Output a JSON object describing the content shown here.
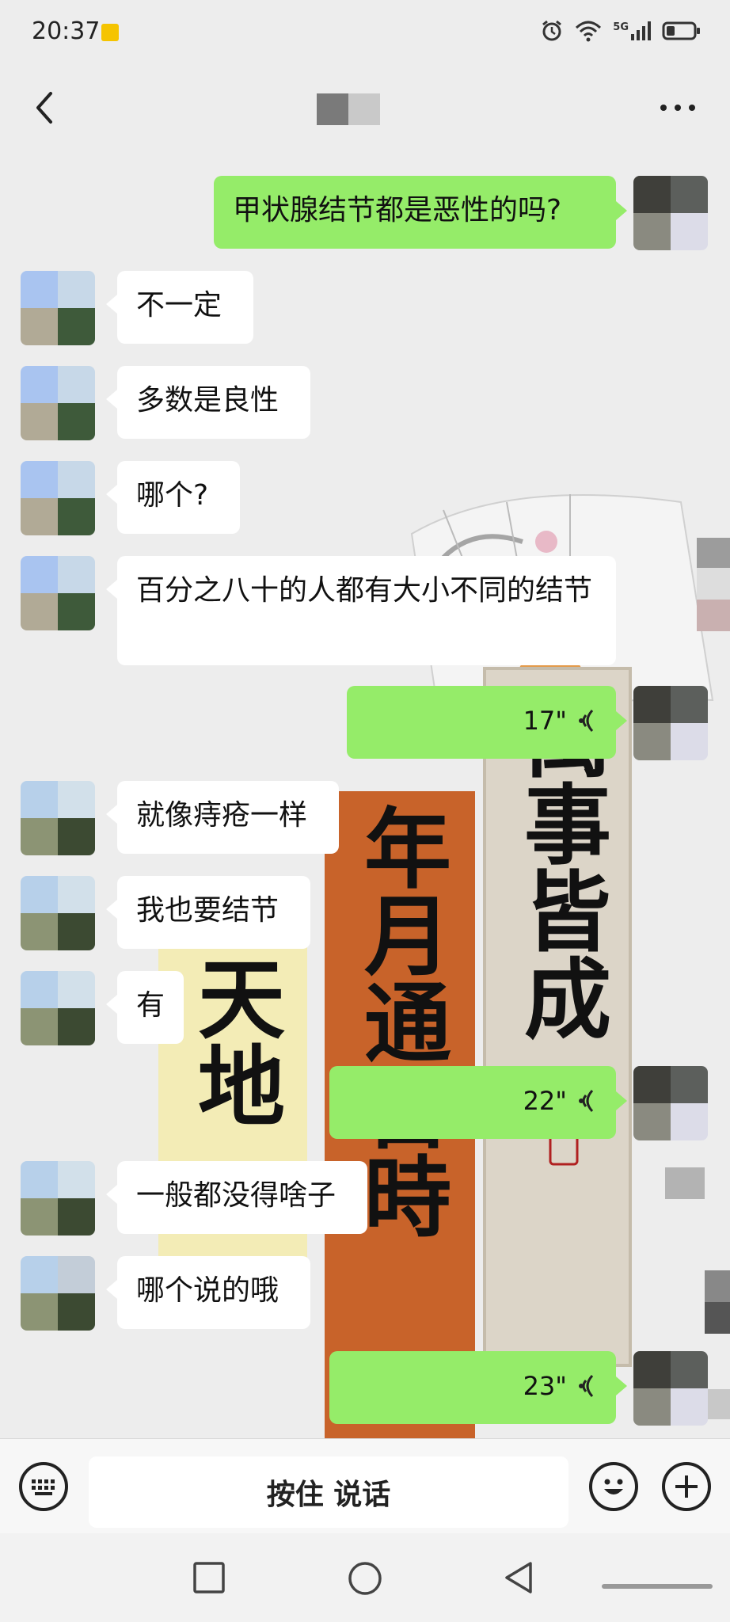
{
  "status_bar": {
    "time": "20:37",
    "icons": [
      "alarm-icon",
      "wifi-icon",
      "signal-5g-icon",
      "battery-icon"
    ],
    "network_label": "5G"
  },
  "nav": {
    "back_icon": "chevron-left-icon",
    "more_icon": "more-dots-icon"
  },
  "messages": [
    {
      "side": "out",
      "type": "text",
      "text": "甲状腺结节都是恶性的吗?"
    },
    {
      "side": "in",
      "type": "text",
      "text": "不一定"
    },
    {
      "side": "in",
      "type": "text",
      "text": "多数是良性"
    },
    {
      "side": "in",
      "type": "text",
      "text": "哪个?"
    },
    {
      "side": "in",
      "type": "text",
      "text": "百分之八十的人都有大小不同的结节"
    },
    {
      "side": "out",
      "type": "voice",
      "duration": "17\""
    },
    {
      "side": "in",
      "type": "text",
      "text": "就像痔疮一样"
    },
    {
      "side": "in",
      "type": "text",
      "text": "我也要结节"
    },
    {
      "side": "in",
      "type": "text",
      "text": "有"
    },
    {
      "side": "out",
      "type": "voice",
      "duration": "22\""
    },
    {
      "side": "in",
      "type": "text",
      "text": "一般都没得啥子"
    },
    {
      "side": "in",
      "type": "text",
      "text": "哪个说的哦"
    },
    {
      "side": "out",
      "type": "voice",
      "duration": "23\""
    }
  ],
  "background_calligraphy": {
    "column1": "天地",
    "column2": "年月通日時",
    "column3": "萬事皆成"
  },
  "input_bar": {
    "keyboard_icon": "keyboard-icon",
    "hold_to_talk": "按住 说话",
    "emoji_icon": "emoji-icon",
    "plus_icon": "plus-icon"
  },
  "system_nav": {
    "icons": [
      "recent-apps-square-icon",
      "home-circle-icon",
      "back-triangle-icon"
    ]
  },
  "colors": {
    "background": "#ededed",
    "outgoing_bubble": "#95ec69",
    "incoming_bubble": "#ffffff"
  }
}
